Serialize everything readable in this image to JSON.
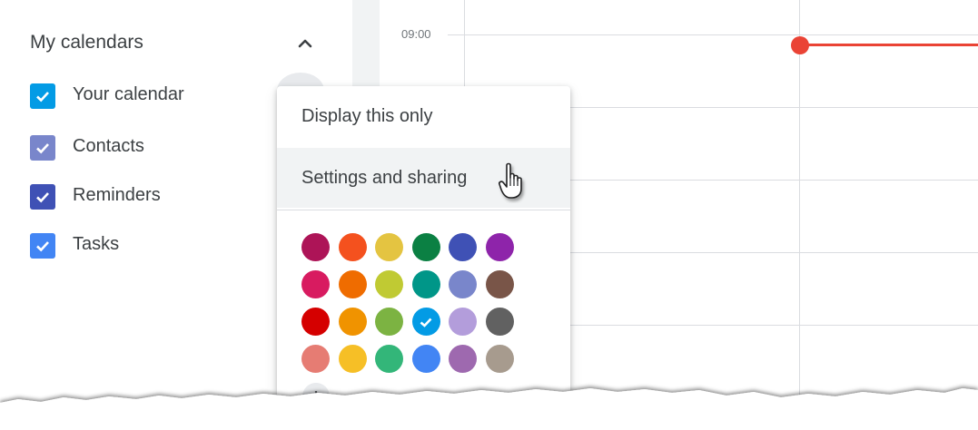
{
  "sidebar": {
    "title": "My calendars",
    "collapse_icon": "chevron-up-icon",
    "items": [
      {
        "label": "Your calendar",
        "color": "#039be5"
      },
      {
        "label": "Contacts",
        "color": "#7986cb"
      },
      {
        "label": "Reminders",
        "color": "#3f51b5"
      },
      {
        "label": "Tasks",
        "color": "#4285f4"
      }
    ]
  },
  "grid": {
    "time_label": "09:00",
    "now_indicator_color": "#ea4335"
  },
  "menu": {
    "items": [
      {
        "label": "Display this only"
      },
      {
        "label": "Settings and sharing",
        "hovered": true
      }
    ],
    "colors": [
      [
        "#ad1457",
        "#f4511e",
        "#e4c441",
        "#0b8043",
        "#3f51b5",
        "#8e24aa"
      ],
      [
        "#d81b60",
        "#ef6c00",
        "#c0ca33",
        "#009688",
        "#7986cb",
        "#795548"
      ],
      [
        "#d50000",
        "#f09300",
        "#7cb342",
        "#039be5",
        "#b39ddb",
        "#616161"
      ],
      [
        "#e67c73",
        "#f6bf26",
        "#33b679",
        "#4285f4",
        "#9e69af",
        "#a79b8e"
      ]
    ],
    "selected_color": "#039be5",
    "add_color_icon": "plus-icon"
  },
  "cursor": "hand-pointer-icon"
}
